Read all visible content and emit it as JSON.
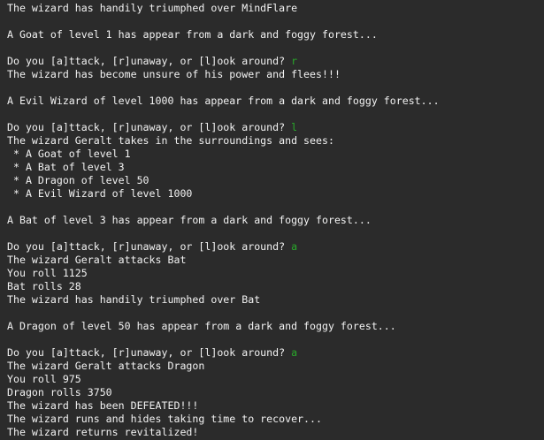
{
  "terminal": {
    "input_color": "#29a82a",
    "lines": [
      {
        "text": "The wizard has handily triumphed over MindFlare"
      },
      {
        "text": ""
      },
      {
        "text": "A Goat of level 1 has appear from a dark and foggy forest..."
      },
      {
        "text": ""
      },
      {
        "text": "Do you [a]ttack, [r]unaway, or [l]ook around?",
        "input": "r"
      },
      {
        "text": "The wizard has become unsure of his power and flees!!!"
      },
      {
        "text": ""
      },
      {
        "text": "A Evil Wizard of level 1000 has appear from a dark and foggy forest..."
      },
      {
        "text": ""
      },
      {
        "text": "Do you [a]ttack, [r]unaway, or [l]ook around?",
        "input": "l"
      },
      {
        "text": "The wizard Geralt takes in the surroundings and sees:"
      },
      {
        "text": " * A Goat of level 1"
      },
      {
        "text": " * A Bat of level 3"
      },
      {
        "text": " * A Dragon of level 50"
      },
      {
        "text": " * A Evil Wizard of level 1000"
      },
      {
        "text": ""
      },
      {
        "text": "A Bat of level 3 has appear from a dark and foggy forest..."
      },
      {
        "text": ""
      },
      {
        "text": "Do you [a]ttack, [r]unaway, or [l]ook around?",
        "input": "a"
      },
      {
        "text": "The wizard Geralt attacks Bat"
      },
      {
        "text": "You roll 1125"
      },
      {
        "text": "Bat rolls 28"
      },
      {
        "text": "The wizard has handily triumphed over Bat"
      },
      {
        "text": ""
      },
      {
        "text": "A Dragon of level 50 has appear from a dark and foggy forest..."
      },
      {
        "text": ""
      },
      {
        "text": "Do you [a]ttack, [r]unaway, or [l]ook around?",
        "input": "a"
      },
      {
        "text": "The wizard Geralt attacks Dragon"
      },
      {
        "text": "You roll 975"
      },
      {
        "text": "Dragon rolls 3750"
      },
      {
        "text": "The wizard has been DEFEATED!!!"
      },
      {
        "text": "The wizard runs and hides taking time to recover..."
      },
      {
        "text": "The wizard returns revitalized!"
      }
    ]
  }
}
